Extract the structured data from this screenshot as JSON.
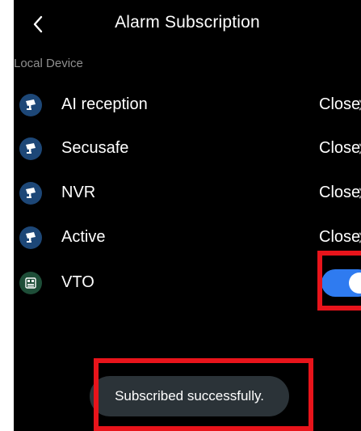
{
  "header": {
    "title": "Alarm Subscription",
    "back_icon": "chevron-left-icon"
  },
  "section": {
    "label": "Local Device"
  },
  "devices": [
    {
      "name": "AI reception",
      "status": "Close",
      "icon": "camera-icon"
    },
    {
      "name": "Secusafe",
      "status": "Close",
      "icon": "camera-icon"
    },
    {
      "name": "NVR",
      "status": "Close",
      "icon": "camera-icon"
    },
    {
      "name": "Active",
      "status": "Close",
      "icon": "camera-icon"
    },
    {
      "name": "VTO",
      "toggle_on": true,
      "icon": "door-station-icon"
    }
  ],
  "toast": {
    "message": "Subscribed successfully."
  },
  "colors": {
    "background": "#000000",
    "camera_icon_bg": "#1d4777",
    "vto_icon_bg": "#1e4e38",
    "toggle_on": "#2f7bf0",
    "toast_bg": "#2b3338",
    "highlight": "#e8141b",
    "section_label": "#8f8f8f"
  }
}
